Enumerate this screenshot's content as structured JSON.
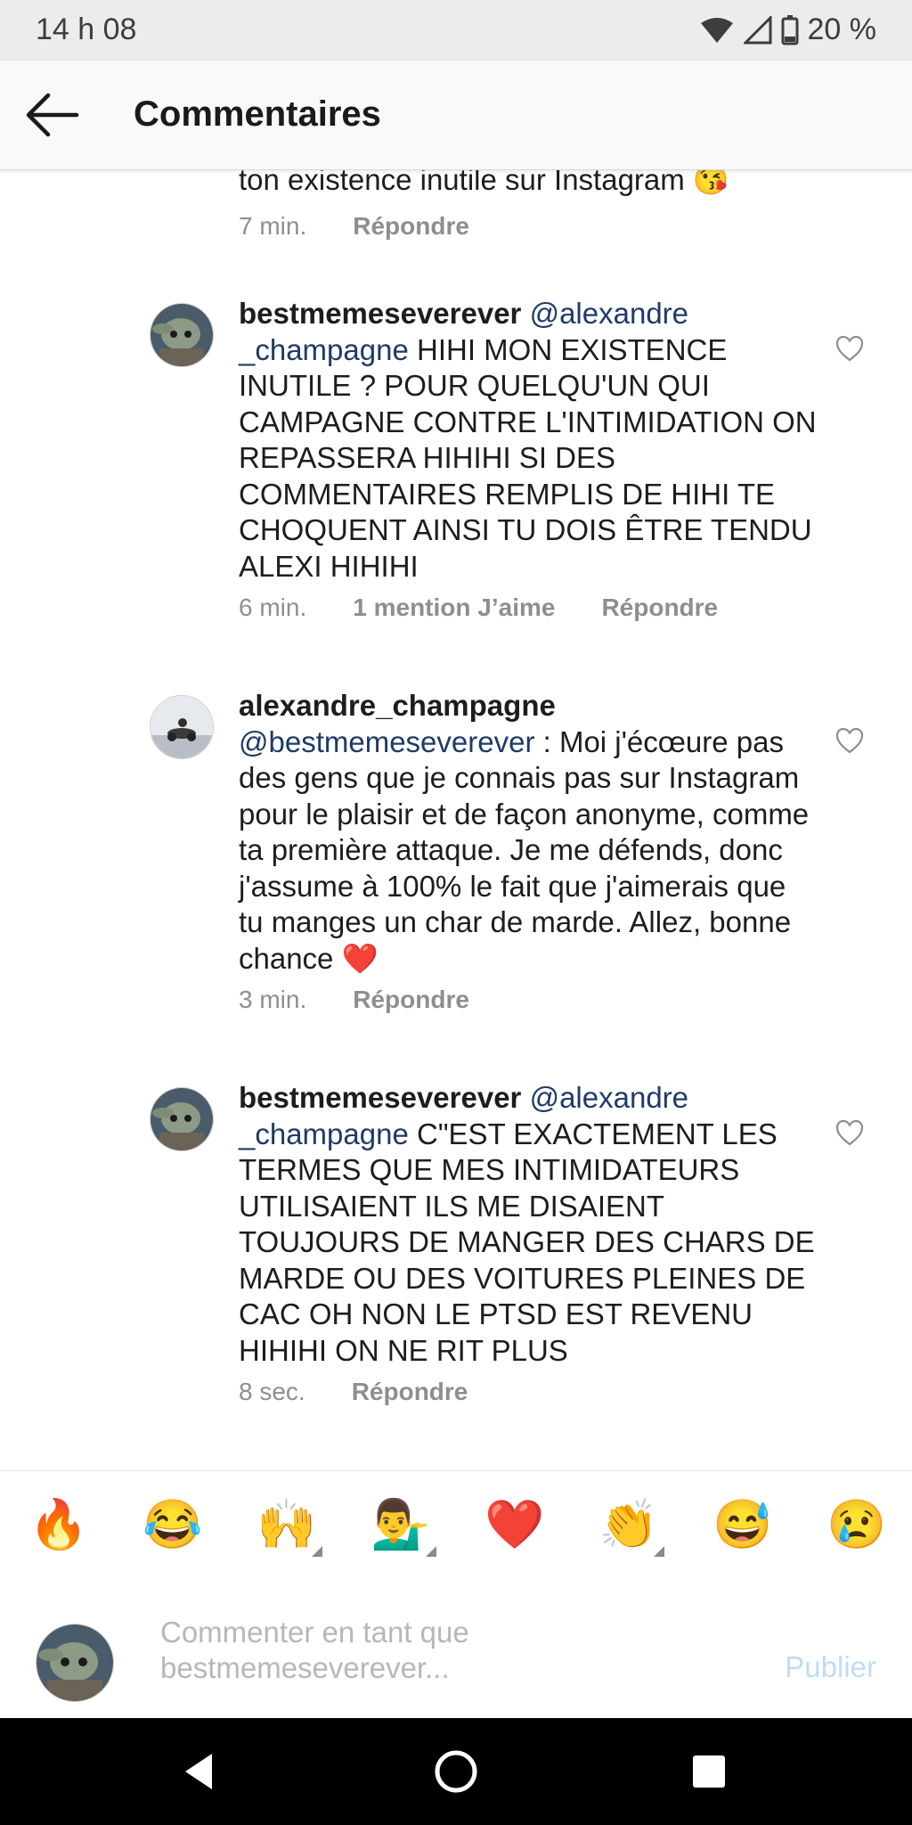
{
  "status_bar": {
    "time": "14 h 08",
    "battery": "20 %"
  },
  "app_bar": {
    "title": "Commentaires"
  },
  "comments": [
    {
      "text": "ton existence inutile sur Instagram 😘",
      "time": "7 min.",
      "reply": "Répondre"
    },
    {
      "username": "bestmemeseverever",
      "mention": "@alexandre _champagne",
      "body": " HIHI MON EXISTENCE INUTILE ? POUR QUELQU'UN QUI CAMPAGNE CONTRE L'INTIMIDATION ON REPASSERA HIHIHI SI DES COMMENTAIRES REMPLIS DE HIHI TE CHOQUENT AINSI TU DOIS ÊTRE TENDU ALEXI HIHIHI",
      "time": "6 min.",
      "likes": "1 mention J’aime",
      "reply": "Répondre"
    },
    {
      "username": "alexandre_champagne",
      "mention": "@bestmemeseverever",
      "body": " : Moi j'écœure pas des gens que je connais pas sur Instagram pour le plaisir et de façon anonyme, comme ta première attaque. Je me défends, donc j'assume à 100% le fait que j'aimerais que tu manges un char de marde. Allez, bonne chance ❤️",
      "time": "3 min.",
      "reply": "Répondre"
    },
    {
      "username": "bestmemeseverever",
      "mention": "@alexandre _champagne",
      "body": " C\"EST EXACTEMENT LES TERMES QUE MES INTIMIDATEURS UTILISAIENT ILS ME DISAIENT TOUJOURS DE MANGER DES CHARS DE MARDE OU DES VOITURES PLEINES DE CAC OH NON LE PTSD EST REVENU HIHIHI ON NE RIT PLUS",
      "time": "8 sec.",
      "reply": "Répondre"
    }
  ],
  "emoji_bar": [
    "🔥",
    "😂",
    "🙌",
    "💁‍♂️",
    "❤️",
    "👏",
    "😅",
    "😢"
  ],
  "composer": {
    "placeholder": "Commenter en tant que bestmemeseverever...",
    "publish": "Publier"
  },
  "icons": {
    "back": "arrow-left-icon",
    "like": "heart-outline-icon",
    "nav": [
      "back-triangle-icon",
      "home-circle-icon",
      "recents-square-icon"
    ]
  }
}
